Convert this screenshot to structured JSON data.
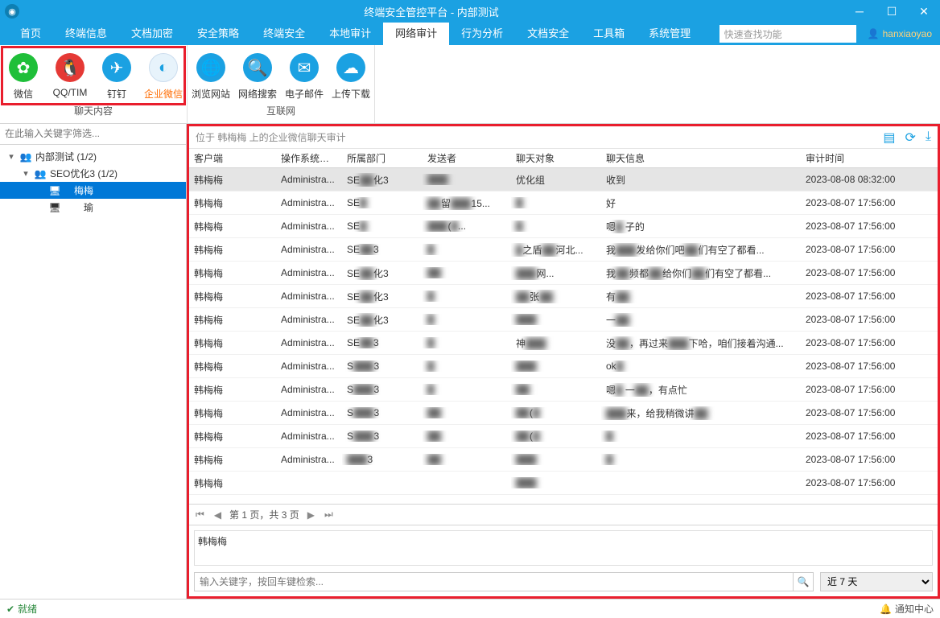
{
  "window": {
    "title": "终端安全管控平台 - 内部测试"
  },
  "menu": {
    "items": [
      "首页",
      "终端信息",
      "文档加密",
      "安全策略",
      "终端安全",
      "本地审计",
      "网络审计",
      "行为分析",
      "文档安全",
      "工具箱",
      "系统管理"
    ],
    "active_index": 6,
    "search_placeholder": "快速查找功能",
    "user": "hanxiaoyao"
  },
  "ribbon": {
    "groups": [
      {
        "label": "聊天内容",
        "items": [
          {
            "label": "微信",
            "color": "#1fbf39",
            "glyph": "✿"
          },
          {
            "label": "QQ/TIM",
            "color": "#e53935",
            "glyph": "🐧"
          },
          {
            "label": "钉钉",
            "color": "#1ba1e2",
            "glyph": "✈"
          },
          {
            "label": "企业微信",
            "color": "#e7f3fb",
            "glyph": "◐",
            "active": true
          }
        ]
      },
      {
        "label": "互联网",
        "items": [
          {
            "label": "浏览网站",
            "color": "#1ba1e2",
            "glyph": "🌐"
          },
          {
            "label": "网络搜索",
            "color": "#1ba1e2",
            "glyph": "🔍"
          },
          {
            "label": "电子邮件",
            "color": "#1ba1e2",
            "glyph": "✉"
          },
          {
            "label": "上传下载",
            "color": "#1ba1e2",
            "glyph": "☁"
          }
        ]
      }
    ]
  },
  "sidebar": {
    "filter_placeholder": "在此输入关键字筛选...",
    "nodes": [
      {
        "indent": 0,
        "tw": "▾",
        "icon": "👥",
        "label": "内部测试 (1/2)"
      },
      {
        "indent": 1,
        "tw": "▾",
        "icon": "👥",
        "label": "SEO优化3 (1/2)"
      },
      {
        "indent": 2,
        "tw": "",
        "icon": "🖥",
        "label": "　梅梅",
        "selected": true
      },
      {
        "indent": 2,
        "tw": "",
        "icon": "🖥",
        "label": "　　瑜"
      }
    ]
  },
  "content": {
    "path": "位于 韩梅梅 上的企业微信聊天审计",
    "columns": [
      "客户端",
      "操作系统账户",
      "所属部门",
      "发送者",
      "聊天对象",
      "聊天信息",
      "审计时间"
    ],
    "rows": [
      {
        "sel": true,
        "c": [
          "韩梅梅",
          "Administra...",
          "SE▒▒化3",
          "▒▒▒▒▒▒",
          "优化组",
          "收到",
          "2023-08-08 08:32:00"
        ]
      },
      {
        "c": [
          "韩梅梅",
          "Administra...",
          "SE▒",
          "▒▒留▒▒▒15...",
          "▒",
          "好",
          "2023-08-07 17:56:00"
        ]
      },
      {
        "c": [
          "韩梅梅",
          "Administra...",
          "SE▒",
          "▒▒▒(▒...",
          "▒",
          "嗯▒ 子的",
          "2023-08-07 17:56:00"
        ]
      },
      {
        "c": [
          "韩梅梅",
          "Administra...",
          "SE▒▒3",
          "▒",
          "▒之盾▒▒河北...",
          "我▒▒▒▒发给你们吧▒▒们有空了都看...",
          "2023-08-07 17:56:00"
        ]
      },
      {
        "c": [
          "韩梅梅",
          "Administra...",
          "SE▒▒化3",
          "▒▒",
          "▒▒▒▒▒网...",
          "我▒▒频都▒▒给你们▒▒们有空了都看...",
          "2023-08-07 17:56:00"
        ]
      },
      {
        "c": [
          "韩梅梅",
          "Administra...",
          "SE▒▒化3",
          "▒",
          "▒▒张▒▒",
          "有▒▒",
          "2023-08-07 17:56:00"
        ]
      },
      {
        "c": [
          "韩梅梅",
          "Administra...",
          "SE▒▒化3",
          "▒",
          "▒▒▒",
          "一▒▒",
          "2023-08-07 17:56:00"
        ]
      },
      {
        "c": [
          "韩梅梅",
          "Administra...",
          "SE▒▒3",
          "▒",
          "神▒▒▒",
          "没▒▒，再过来▒▒▒下哈，咱们接着沟通...",
          "2023-08-07 17:56:00"
        ]
      },
      {
        "c": [
          "韩梅梅",
          "Administra...",
          "S▒▒▒3",
          "▒",
          "▒▒▒",
          "ok▒",
          "2023-08-07 17:56:00"
        ]
      },
      {
        "c": [
          "韩梅梅",
          "Administra...",
          "S▒▒▒3",
          "▒",
          "▒▒",
          "嗯▒ 一▒▒，有点忙",
          "2023-08-07 17:56:00"
        ]
      },
      {
        "c": [
          "韩梅梅",
          "Administra...",
          "S▒▒▒3",
          "▒▒",
          "▒▒(▒",
          "▒▒▒▒来，给我稍微讲▒▒",
          "2023-08-07 17:56:00"
        ]
      },
      {
        "c": [
          "韩梅梅",
          "Administra...",
          "S▒▒▒3",
          "▒▒",
          "▒▒(▒",
          "▒",
          "2023-08-07 17:56:00"
        ]
      },
      {
        "c": [
          "韩梅梅",
          "Administra...",
          "▒▒▒3",
          "▒▒",
          "▒▒▒",
          "▒",
          "2023-08-07 17:56:00"
        ]
      },
      {
        "c": [
          "韩梅梅",
          "",
          "",
          "",
          "▒▒▒▒",
          "",
          "2023-08-07 17:56:00"
        ]
      }
    ],
    "pager": "第 1 页，共 3 页",
    "detail_name": "韩梅梅",
    "detail_search_placeholder": "输入关键字，按回车键检索...",
    "detail_time_filter": "近 7 天"
  },
  "status": {
    "ready": "就绪",
    "notif": "通知中心"
  }
}
